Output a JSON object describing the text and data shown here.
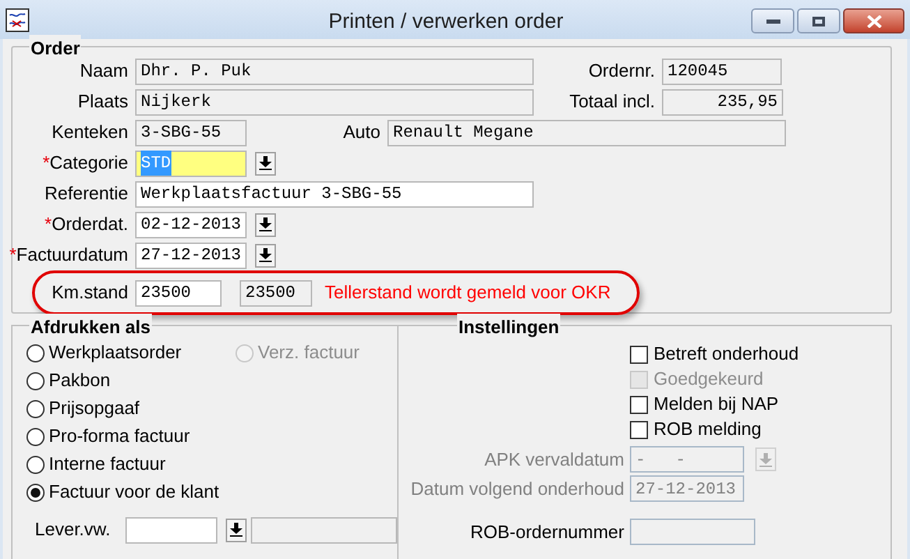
{
  "window": {
    "title": "Printen / verwerken order"
  },
  "required_marker": "*",
  "order": {
    "legend": "Order",
    "naam": {
      "label": "Naam",
      "value": "Dhr. P. Puk",
      "editable": false
    },
    "ordernr": {
      "label": "Ordernr.",
      "value": "120045",
      "editable": false
    },
    "plaats": {
      "label": "Plaats",
      "value": "Nijkerk",
      "editable": false
    },
    "totaal": {
      "label": "Totaal incl.",
      "value": "235,95",
      "editable": false
    },
    "kenteken": {
      "label": "Kenteken",
      "value": "3-SBG-55",
      "editable": false
    },
    "auto": {
      "label": "Auto",
      "value": "Renault Megane",
      "editable": false
    },
    "categorie": {
      "label": "Categorie",
      "value": "STD",
      "required": true,
      "focused": true
    },
    "referentie": {
      "label": "Referentie",
      "value": "Werkplaatsfactuur 3-SBG-55",
      "editable": true
    },
    "orderdatum": {
      "label": "Orderdat.",
      "value": "02-12-2013",
      "required": true
    },
    "factuurdatum": {
      "label": "Factuurdatum",
      "value": "27-12-2013",
      "required": true
    },
    "km_stand": {
      "label": "Km.stand",
      "value": "23500",
      "reading": "23500",
      "note": "Tellerstand wordt gemeld voor OKR",
      "circled": true
    }
  },
  "afdrukken": {
    "legend": "Afdrukken als",
    "radio_rows": [
      [
        {
          "label": "Werkplaatsorder",
          "selected": false,
          "disabled": false
        },
        {
          "label": "Verz. factuur",
          "selected": false,
          "disabled": true
        }
      ],
      [
        {
          "label": "Pakbon",
          "selected": false,
          "disabled": false
        }
      ],
      [
        {
          "label": "Prijsopgaaf",
          "selected": false,
          "disabled": false
        }
      ],
      [
        {
          "label": "Pro-forma factuur",
          "selected": false,
          "disabled": false
        }
      ],
      [
        {
          "label": "Interne factuur",
          "selected": false,
          "disabled": false
        }
      ],
      [
        {
          "label": "Factuur voor de klant",
          "selected": true,
          "disabled": false
        }
      ]
    ],
    "lever_vw": {
      "label": "Lever.vw."
    }
  },
  "instellingen": {
    "legend": "Instellingen",
    "checkboxes": [
      {
        "label": "Betreft onderhoud",
        "checked": false,
        "disabled": false
      },
      {
        "label": "Goedgekeurd",
        "checked": false,
        "disabled": true
      },
      {
        "label": "Melden bij NAP",
        "checked": false,
        "disabled": false
      },
      {
        "label": "ROB melding",
        "checked": false,
        "disabled": false
      }
    ],
    "apk": {
      "label": "APK vervaldatum",
      "value": "-   -",
      "disabled": true
    },
    "volgend_onderhoud": {
      "label": "Datum volgend onderhoud",
      "value": "27-12-2013",
      "disabled": true
    },
    "rob_ordernummer": {
      "label": "ROB-ordernummer"
    }
  }
}
